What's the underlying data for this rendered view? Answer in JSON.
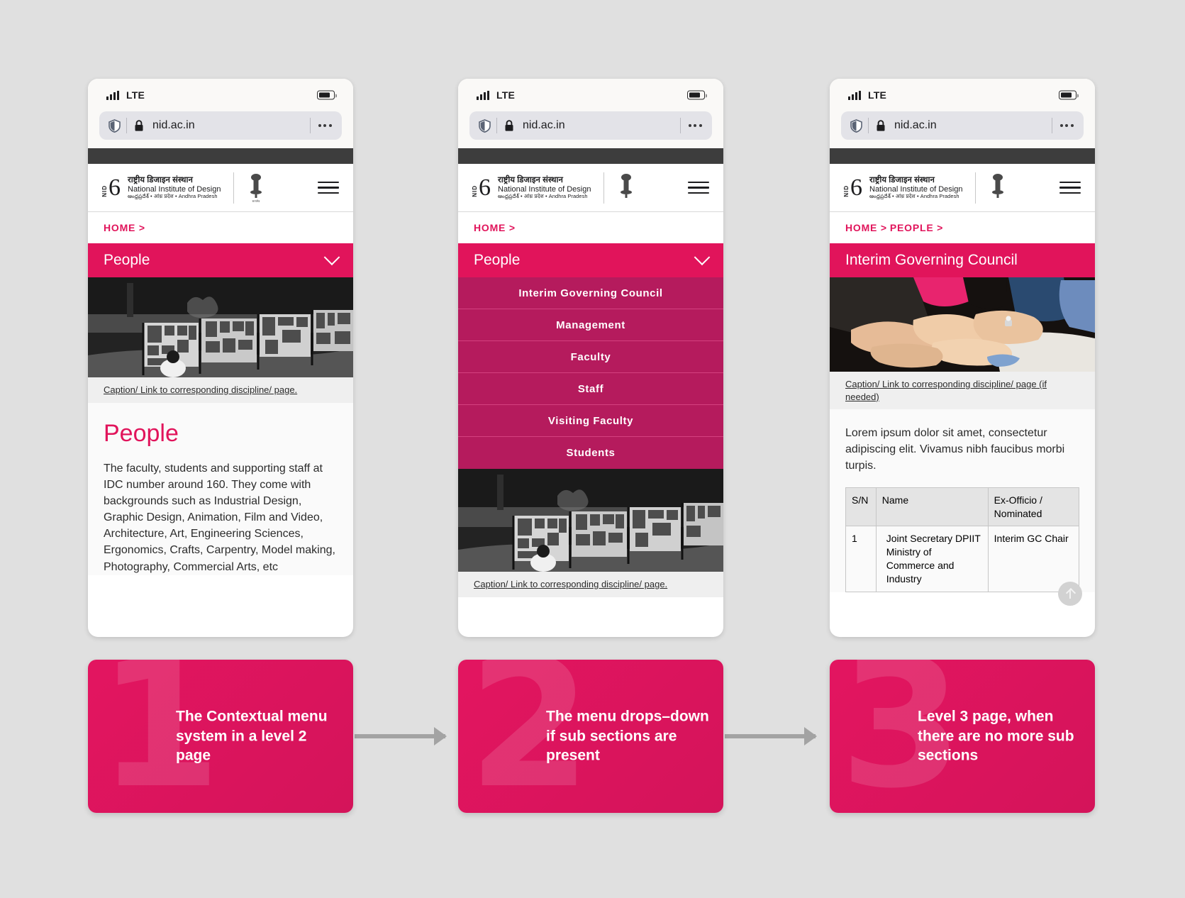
{
  "statusbar": {
    "network_label": "LTE",
    "signal_icon": "signal-bars-icon",
    "battery_icon": "battery-icon"
  },
  "browser": {
    "url": "nid.ac.in",
    "shield_icon": "shield-icon",
    "lock_icon": "lock-icon",
    "menu_icon": "more-options-icon"
  },
  "site": {
    "logo": {
      "nid_mark": "NID",
      "hindi": "राष्ट्रीय डिजाइन संस्थान",
      "english": "National Institute of Design",
      "sub": "ఆంధ్రప్రదేశ్ • आंध्र प्रदेश • Andhra Pradesh",
      "emblem_icon": "ashoka-emblem-icon"
    },
    "hamburger_icon": "hamburger-menu-icon"
  },
  "colors": {
    "accent": "#e1145b",
    "accent_dark": "#b51b5d",
    "page_bg": "#e0e0e0",
    "dark_bar": "#3d3d3d",
    "arrow_gray": "#a3a3a3"
  },
  "phone1": {
    "breadcrumb": "HOME >",
    "ctx_title": "People",
    "ctx_chevron_icon": "chevron-down-icon",
    "hero_alt": "gallery-exhibition-photo",
    "caption": "Caption/ Link to corresponding discipline/ page.",
    "heading": "People",
    "paragraph": "The faculty, students and supporting staff at IDC number around 160. They come with backgrounds such as Industrial Design, Graphic Design, Animation, Film and Video, Architecture, Art, Engineering Sciences, Ergonomics, Crafts, Carpentry, Model making, Photography, Commercial Arts, etc"
  },
  "phone2": {
    "breadcrumb": "HOME >",
    "ctx_title": "People",
    "ctx_chevron_icon": "chevron-down-icon",
    "menu_items": [
      "Interim Governing Council",
      "Management",
      "Faculty",
      "Staff",
      "Visiting Faculty",
      "Students"
    ],
    "hero_alt": "gallery-exhibition-photo",
    "caption": "Caption/ Link to corresponding discipline/ page."
  },
  "phone3": {
    "breadcrumb_home": "HOME >",
    "breadcrumb_people": "PEOPLE >",
    "ctx_title": "Interim Governing Council",
    "hero_alt": "hands-together-teamwork-photo",
    "caption": "Caption/ Link to corresponding discipline/ page (if needed)",
    "paragraph": "Lorem ipsum dolor sit amet, consectetur adipiscing elit. Vivamus nibh faucibus morbi turpis.",
    "table": {
      "headers": [
        "S/N",
        "Name",
        "Ex-Officio / Nominated"
      ],
      "rows": [
        [
          "1",
          "Joint Secretary DPIIT Ministry of Commerce and Industry",
          "Interim GC Chair"
        ]
      ]
    },
    "scroll_top_icon": "scroll-to-top-icon"
  },
  "steps": [
    {
      "number": "1",
      "text": "The Contextual menu system in a level 2 page"
    },
    {
      "number": "2",
      "text": "The menu drops–down if sub sections are present"
    },
    {
      "number": "3",
      "text": "Level 3 page, when there are no more sub sections"
    }
  ],
  "flow": {
    "arrow_icon": "right-arrow-icon"
  }
}
